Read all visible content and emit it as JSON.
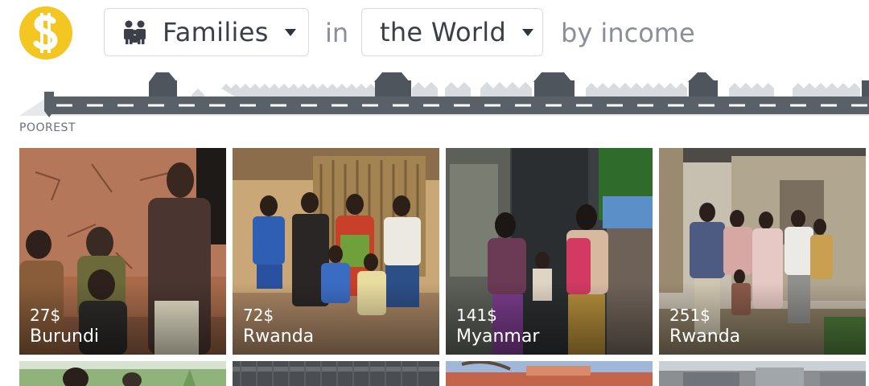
{
  "header": {
    "thing_select": {
      "label": "Families",
      "icon": "people-icon"
    },
    "in_word": "in",
    "place_select": {
      "label": "the World"
    },
    "by_word": "by income",
    "logo_icon": "dollar-logo-icon"
  },
  "street": {
    "left_label": "POOREST"
  },
  "colors": {
    "logo": "#f3c622",
    "road": "#5a6068",
    "house_dark": "#4f555d",
    "house_light": "#d9dcdf"
  },
  "cards": [
    {
      "income": "27$",
      "country": "Burundi"
    },
    {
      "income": "72$",
      "country": "Rwanda"
    },
    {
      "income": "141$",
      "country": "Myanmar"
    },
    {
      "income": "251$",
      "country": "Rwanda"
    }
  ]
}
